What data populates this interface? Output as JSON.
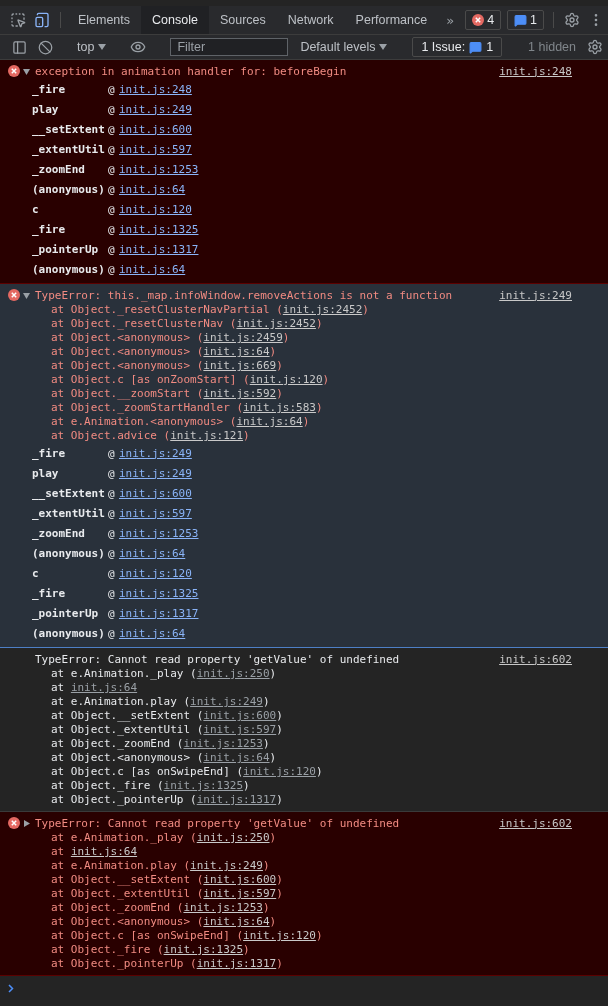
{
  "tabs": [
    {
      "label": "Elements",
      "selected": false
    },
    {
      "label": "Console",
      "selected": true
    },
    {
      "label": "Sources",
      "selected": false
    },
    {
      "label": "Network",
      "selected": false
    },
    {
      "label": "Performance",
      "selected": false
    }
  ],
  "more_tabs": "»",
  "error_count": "4",
  "message_count": "1",
  "toolbar": {
    "context": "top",
    "filter": {
      "placeholder": "Filter"
    },
    "levels": "Default levels",
    "issues_label": "1 Issue:",
    "issues_count": "1",
    "hidden": "1 hidden"
  },
  "messages": [
    {
      "kind": "error",
      "expanded": true,
      "focused": false,
      "text": "exception in animation handler for: beforeBegin",
      "source": "init.js:248",
      "frames": [
        {
          "fn": "_fire",
          "at": "@",
          "link": "init.js:248"
        },
        {
          "fn": "play",
          "at": "@",
          "link": "init.js:249"
        },
        {
          "fn": "__setExtent",
          "at": "@",
          "link": "init.js:600"
        },
        {
          "fn": "_extentUtil",
          "at": "@",
          "link": "init.js:597"
        },
        {
          "fn": "_zoomEnd",
          "at": "@",
          "link": "init.js:1253"
        },
        {
          "fn": "(anonymous)",
          "at": "@",
          "link": "init.js:64"
        },
        {
          "fn": "c",
          "at": "@",
          "link": "init.js:120"
        },
        {
          "fn": "_fire",
          "at": "@",
          "link": "init.js:1325"
        },
        {
          "fn": "_pointerUp",
          "at": "@",
          "link": "init.js:1317"
        },
        {
          "fn": "(anonymous)",
          "at": "@",
          "link": "init.js:64"
        }
      ]
    },
    {
      "kind": "error",
      "expanded": true,
      "focused": true,
      "text": "TypeError: this._map.infoWindow.removeActions is not a function",
      "source": "init.js:249",
      "stack": [
        {
          "pre": "at Object._resetClusterNavPartial (",
          "link": "init.js:2452",
          "post": ")"
        },
        {
          "pre": "at Object._resetClusterNav (",
          "link": "init.js:2452",
          "post": ")"
        },
        {
          "pre": "at Object.<anonymous> (",
          "link": "init.js:2459",
          "post": ")"
        },
        {
          "pre": "at Object.<anonymous> (",
          "link": "init.js:64",
          "post": ")"
        },
        {
          "pre": "at Object.<anonymous> (",
          "link": "init.js:669",
          "post": ")"
        },
        {
          "pre": "at Object.c [as onZoomStart] (",
          "link": "init.js:120",
          "post": ")"
        },
        {
          "pre": "at Object.__zoomStart (",
          "link": "init.js:592",
          "post": ")"
        },
        {
          "pre": "at Object._zoomStartHandler (",
          "link": "init.js:583",
          "post": ")"
        },
        {
          "pre": "at e.Animation.<anonymous> (",
          "link": "init.js:64",
          "post": ")"
        },
        {
          "pre": "at Object.advice (",
          "link": "init.js:121",
          "post": ")"
        }
      ],
      "frames": [
        {
          "fn": "_fire",
          "at": "@",
          "link": "init.js:249"
        },
        {
          "fn": "play",
          "at": "@",
          "link": "init.js:249"
        },
        {
          "fn": "__setExtent",
          "at": "@",
          "link": "init.js:600"
        },
        {
          "fn": "_extentUtil",
          "at": "@",
          "link": "init.js:597"
        },
        {
          "fn": "_zoomEnd",
          "at": "@",
          "link": "init.js:1253"
        },
        {
          "fn": "(anonymous)",
          "at": "@",
          "link": "init.js:64"
        },
        {
          "fn": "c",
          "at": "@",
          "link": "init.js:120"
        },
        {
          "fn": "_fire",
          "at": "@",
          "link": "init.js:1325"
        },
        {
          "fn": "_pointerUp",
          "at": "@",
          "link": "init.js:1317"
        },
        {
          "fn": "(anonymous)",
          "at": "@",
          "link": "init.js:64"
        }
      ]
    },
    {
      "kind": "log",
      "focused": false,
      "text": "TypeError: Cannot read property 'getValue' of undefined",
      "source": "init.js:602",
      "stack": [
        {
          "pre": "at e.Animation._play (",
          "link": "init.js:250",
          "post": ")"
        },
        {
          "pre": "at ",
          "link": "init.js:64"
        },
        {
          "pre": "at e.Animation.play (",
          "link": "init.js:249",
          "post": ")"
        },
        {
          "pre": "at Object.__setExtent (",
          "link": "init.js:600",
          "post": ")"
        },
        {
          "pre": "at Object._extentUtil (",
          "link": "init.js:597",
          "post": ")"
        },
        {
          "pre": "at Object._zoomEnd (",
          "link": "init.js:1253",
          "post": ")"
        },
        {
          "pre": "at Object.<anonymous> (",
          "link": "init.js:64",
          "post": ")"
        },
        {
          "pre": "at Object.c [as onSwipeEnd] (",
          "link": "init.js:120",
          "post": ")"
        },
        {
          "pre": "at Object._fire (",
          "link": "init.js:1325",
          "post": ")"
        },
        {
          "pre": "at Object._pointerUp (",
          "link": "init.js:1317",
          "post": ")"
        }
      ]
    },
    {
      "kind": "error",
      "expanded": false,
      "focused": false,
      "text": "TypeError: Cannot read property 'getValue' of undefined",
      "source": "init.js:602",
      "stack": [
        {
          "pre": "at e.Animation._play (",
          "link": "init.js:250",
          "post": ")"
        },
        {
          "pre": "at ",
          "link": "init.js:64"
        },
        {
          "pre": "at e.Animation.play (",
          "link": "init.js:249",
          "post": ")"
        },
        {
          "pre": "at Object.__setExtent (",
          "link": "init.js:600",
          "post": ")"
        },
        {
          "pre": "at Object._extentUtil (",
          "link": "init.js:597",
          "post": ")"
        },
        {
          "pre": "at Object._zoomEnd (",
          "link": "init.js:1253",
          "post": ")"
        },
        {
          "pre": "at Object.<anonymous> (",
          "link": "init.js:64",
          "post": ")"
        },
        {
          "pre": "at Object.c [as onSwipeEnd] (",
          "link": "init.js:120",
          "post": ")"
        },
        {
          "pre": "at Object._fire (",
          "link": "init.js:1325",
          "post": ")"
        },
        {
          "pre": "at Object._pointerUp (",
          "link": "init.js:1317",
          "post": ")"
        }
      ]
    }
  ]
}
